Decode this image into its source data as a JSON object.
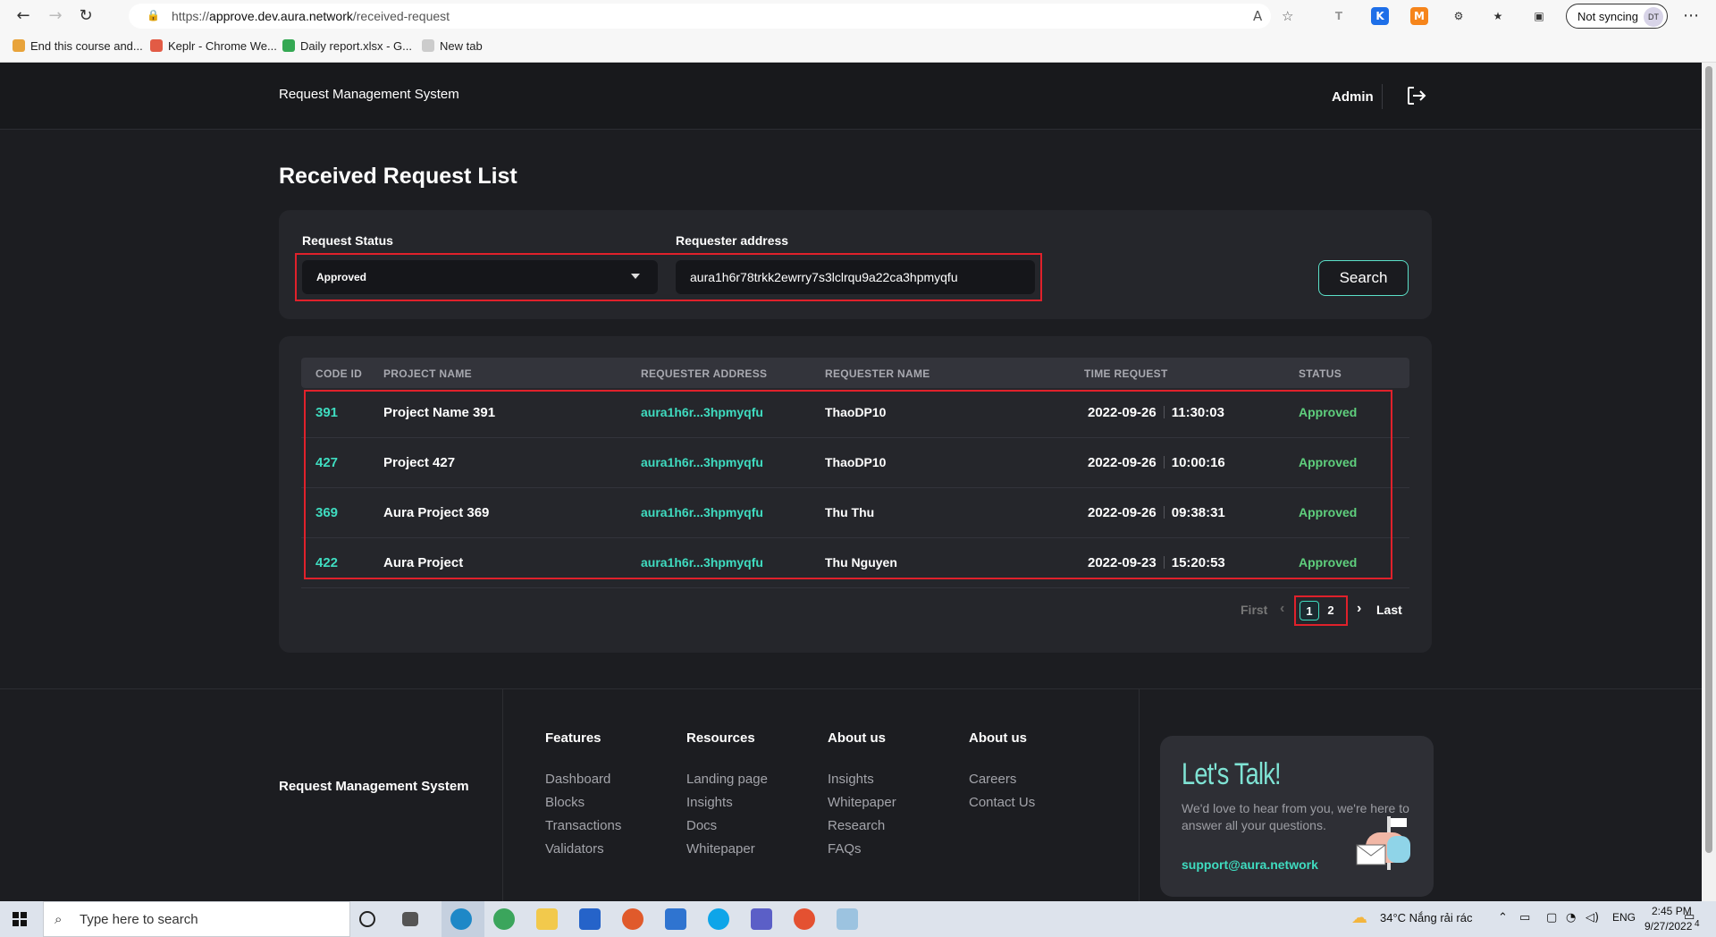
{
  "browser": {
    "url_prefix": "https://",
    "url_host": "approve.dev.aura.network",
    "url_path": "/received-request",
    "sync_label": "Not syncing",
    "avatar": "DT",
    "bookmarks": [
      "End this course and...",
      "Keplr - Chrome We...",
      "Daily report.xlsx - G...",
      "New tab"
    ]
  },
  "header": {
    "app_title": "Request Management System",
    "user": "Admin"
  },
  "page": {
    "title": "Received Request List"
  },
  "filters": {
    "status_label": "Request Status",
    "status_value": "Approved",
    "address_label": "Requester address",
    "address_value": "aura1h6r78trkk2ewrry7s3lclrqu9a22ca3hpmyqfu",
    "search_label": "Search"
  },
  "table": {
    "columns": [
      "CODE ID",
      "PROJECT NAME",
      "REQUESTER ADDRESS",
      "REQUESTER NAME",
      "TIME REQUEST",
      "STATUS"
    ],
    "rows": [
      {
        "code": "391",
        "project": "Project Name 391",
        "address": "aura1h6r...3hpmyqfu",
        "name": "ThaoDP10",
        "date": "2022-09-26",
        "time": "11:30:03",
        "status": "Approved"
      },
      {
        "code": "427",
        "project": "Project 427",
        "address": "aura1h6r...3hpmyqfu",
        "name": "ThaoDP10",
        "date": "2022-09-26",
        "time": "10:00:16",
        "status": "Approved"
      },
      {
        "code": "369",
        "project": "Aura Project 369",
        "address": "aura1h6r...3hpmyqfu",
        "name": "Thu Thu",
        "date": "2022-09-26",
        "time": "09:38:31",
        "status": "Approved"
      },
      {
        "code": "422",
        "project": "Aura Project",
        "address": "aura1h6r...3hpmyqfu",
        "name": "Thu Nguyen",
        "date": "2022-09-23",
        "time": "15:20:53",
        "status": "Approved"
      }
    ]
  },
  "pagination": {
    "first": "First",
    "pages": [
      "1",
      "2"
    ],
    "current": "1",
    "last": "Last"
  },
  "footer": {
    "brand": "Request Management System",
    "columns": [
      {
        "title": "Features",
        "links": [
          "Dashboard",
          "Blocks",
          "Transactions",
          "Validators"
        ]
      },
      {
        "title": "Resources",
        "links": [
          "Landing page",
          "Insights",
          "Docs",
          "Whitepaper"
        ]
      },
      {
        "title": "About us",
        "links": [
          "Insights",
          "Whitepaper",
          "Research",
          "FAQs"
        ]
      },
      {
        "title": "About us",
        "links": [
          "Careers",
          "Contact Us"
        ]
      }
    ],
    "talk_title": "Let's Talk!",
    "talk_text": "We'd love to hear from you, we're here to answer all your questions.",
    "talk_email": "support@aura.network"
  },
  "taskbar": {
    "search_placeholder": "Type here to search",
    "weather": "34°C  Nắng rải rác",
    "lang": "ENG",
    "time": "2:45 PM",
    "date": "9/27/2022",
    "notifications": "4"
  },
  "colors": {
    "accent": "#3fdcc0",
    "approved": "#5fcf7d",
    "highlight": "#e0212b",
    "background": "#1c1d21",
    "card": "#25262b"
  }
}
